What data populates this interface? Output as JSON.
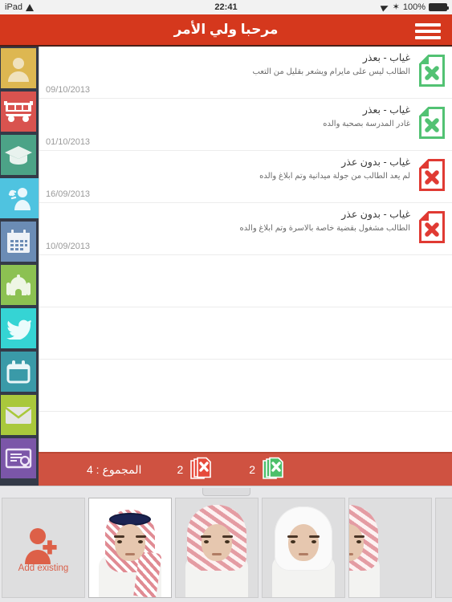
{
  "statusbar": {
    "device": "iPad",
    "wifi_icon": "wifi-icon",
    "time": "22:41",
    "location_icon": "location-arrow-icon",
    "bluetooth_icon": "bluetooth-icon",
    "battery_percent": "100%",
    "battery_icon": "battery-full-icon"
  },
  "header": {
    "title": "مرحبا ولي الأمر",
    "menu_icon": "hamburger-menu-icon",
    "background": "#d5381d"
  },
  "sidebar": {
    "background": "#343a48",
    "items": [
      {
        "name": "profile",
        "icon": "person-icon",
        "color": "#ddb751",
        "active": false
      },
      {
        "name": "transport",
        "icon": "school-bus-icon",
        "color": "#d9534f",
        "active": false
      },
      {
        "name": "academics",
        "icon": "graduation-cap-icon",
        "color": "#4ca387",
        "active": false
      },
      {
        "name": "attendance",
        "icon": "person-waving-icon",
        "color": "#4fc3e0",
        "active": true
      },
      {
        "name": "timetable",
        "icon": "calendar-grid-icon",
        "color": "#6b8cb5",
        "active": false
      },
      {
        "name": "mosque",
        "icon": "mosque-icon",
        "color": "#8cc152",
        "active": false
      },
      {
        "name": "twitter",
        "icon": "twitter-bird-icon",
        "color": "#35d4d4",
        "active": false
      },
      {
        "name": "events",
        "icon": "calendar-icon",
        "color": "#3a9aa8",
        "active": false
      },
      {
        "name": "messages",
        "icon": "envelope-icon",
        "color": "#a9c83c",
        "active": false
      },
      {
        "name": "certificates",
        "icon": "certificate-icon",
        "color": "#7b56a8",
        "active": false
      }
    ]
  },
  "list": {
    "rows": [
      {
        "title": "غياب - بعذر",
        "description": "الطالب ليس على مايرام ويشعر بقليل من التعب",
        "date": "09/10/2013",
        "status": "excused",
        "icon": "document-x-green-icon",
        "icon_color": "#52c273"
      },
      {
        "title": "غياب - بعذر",
        "description": "غادر المدرسة بصحبة والده",
        "date": "01/10/2013",
        "status": "excused",
        "icon": "document-x-green-icon",
        "icon_color": "#52c273"
      },
      {
        "title": "غياب - بدون عذر",
        "description": "لم يعد الطالب من جولة ميدانية وتم ابلاغ والده",
        "date": "16/09/2013",
        "status": "unexcused",
        "icon": "document-x-red-icon",
        "icon_color": "#e03a33"
      },
      {
        "title": "غياب - بدون عذر",
        "description": "الطالب مشغول بقضية خاصة بالاسرة وتم ابلاغ والده",
        "date": "10/09/2013",
        "status": "unexcused",
        "icon": "document-x-red-icon",
        "icon_color": "#e03a33"
      }
    ],
    "empty_row_count": 3
  },
  "summary": {
    "background": "#cf5241",
    "total_label": "المجموع : 4",
    "unexcused_count": "2",
    "unexcused_icon": "documents-stack-x-red-icon",
    "excused_count": "2",
    "excused_icon": "documents-stack-x-green-icon"
  },
  "bottom_strip": {
    "add_existing_label": "Add existing",
    "add_existing_icon": "person-add-icon",
    "accent_color": "#d9604a",
    "cards": [
      {
        "name": "add-existing",
        "type": "action",
        "label": "Add existing",
        "icon": "person-add-icon"
      },
      {
        "name": "student-1",
        "type": "photo",
        "label": "",
        "selected": true,
        "style": "keffiyeh-red-agal"
      },
      {
        "name": "student-2",
        "type": "photo",
        "label": "",
        "selected": false,
        "style": "keffiyeh-red"
      },
      {
        "name": "student-3",
        "type": "photo",
        "label": "",
        "selected": false,
        "style": "keffiyeh-white"
      },
      {
        "name": "student-4",
        "type": "photo",
        "label": "",
        "selected": false,
        "style": "keffiyeh-partial"
      },
      {
        "name": "transfer-school",
        "type": "action",
        "label": "",
        "icon": "person-to-school-icon"
      }
    ]
  }
}
